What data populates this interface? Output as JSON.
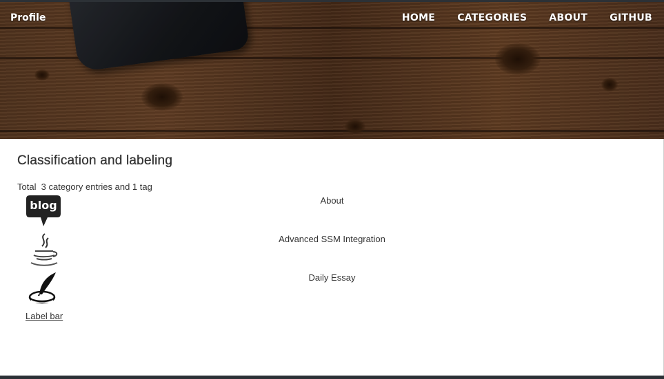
{
  "header": {
    "brand": "Profile",
    "nav": [
      {
        "label": "HOME"
      },
      {
        "label": "CATEGORIES"
      },
      {
        "label": "ABOUT"
      },
      {
        "label": "GITHUB"
      }
    ]
  },
  "main": {
    "title": "Classification and labeling",
    "total_text": "Total  3 category entries and 1 tag",
    "categories": [
      {
        "label": "About",
        "icon": "blog-icon"
      },
      {
        "label": "Advanced SSM Integration",
        "icon": "java-icon"
      },
      {
        "label": "Daily Essay",
        "icon": "quill-icon"
      }
    ],
    "tag_bar_label": "Label bar"
  },
  "blog_icon_text": "blog",
  "colors": {
    "topbar": "#2c3136",
    "text": "#333333",
    "nav_text": "#ffffff"
  }
}
